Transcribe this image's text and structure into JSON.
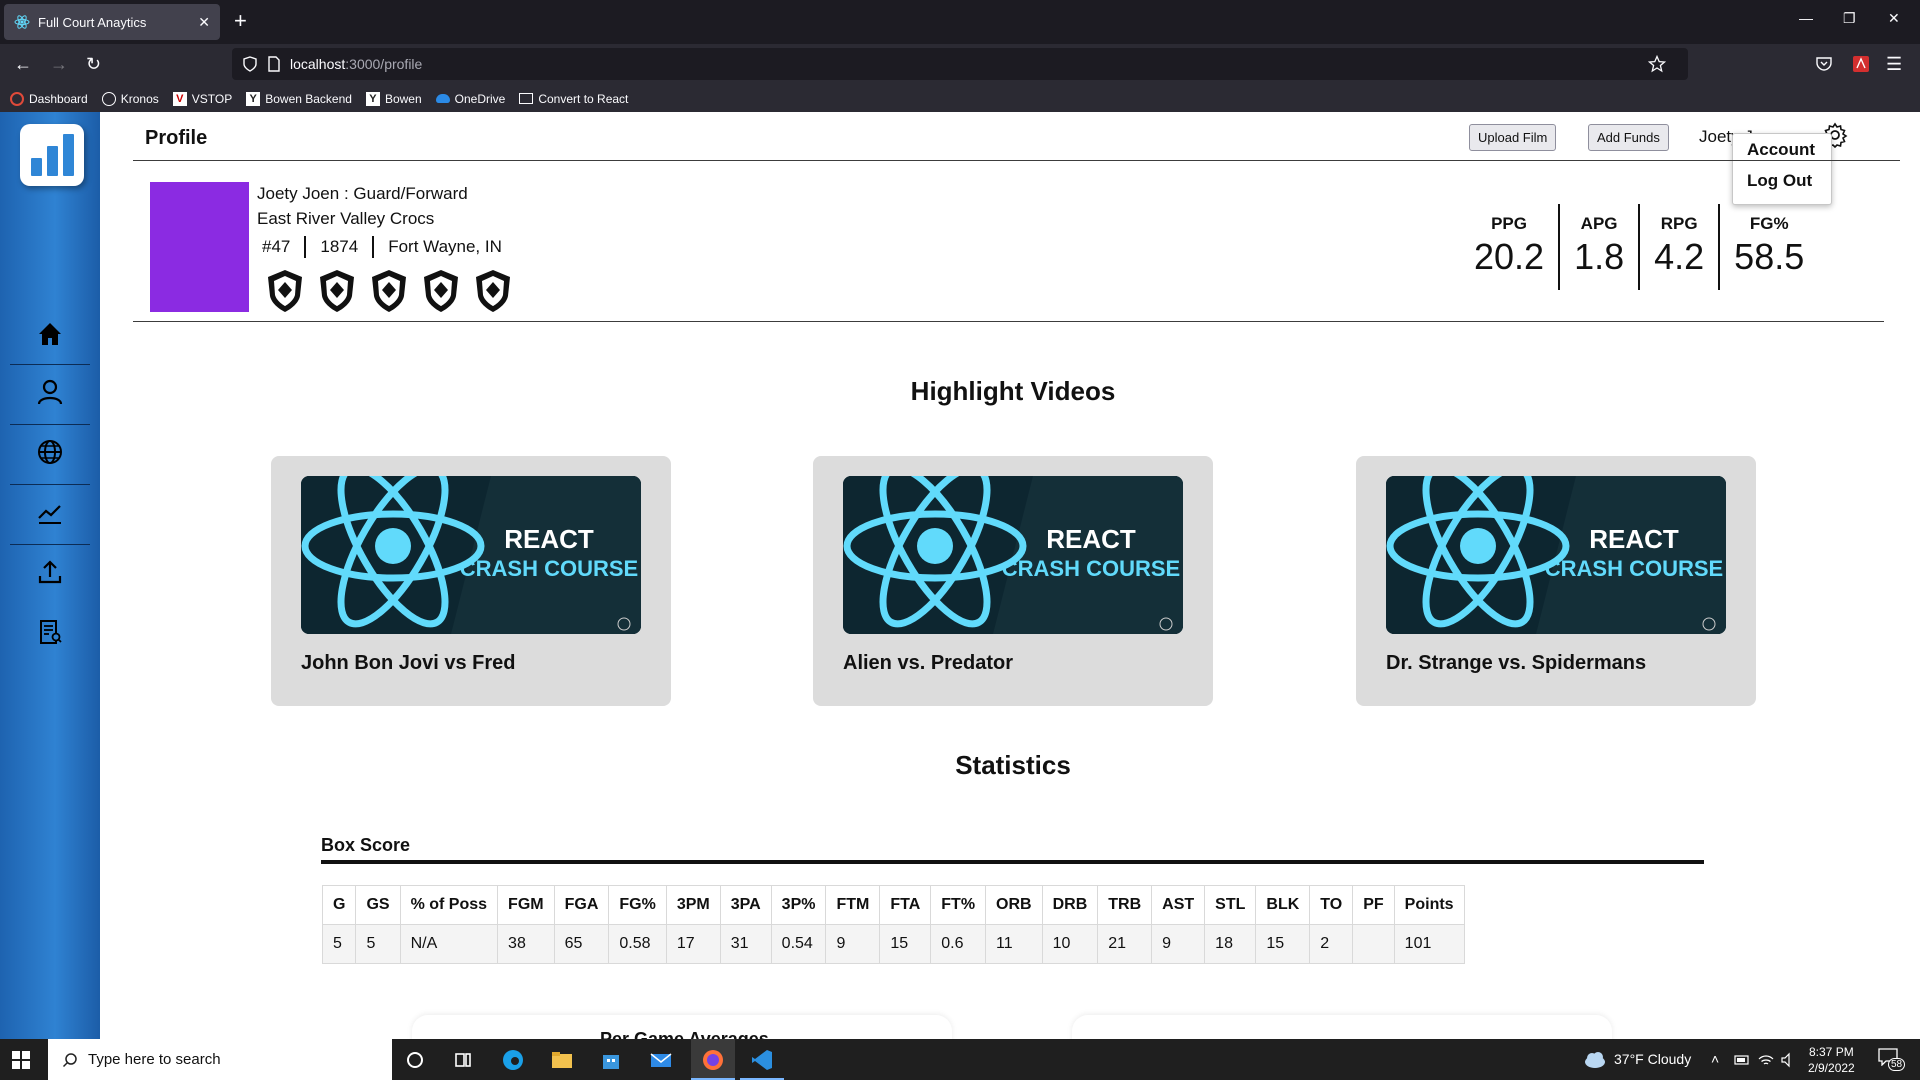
{
  "browser": {
    "tab_title": "Full Court Anaytics",
    "tab_close": "✕",
    "new_tab": "+",
    "url_host": "localhost",
    "url_path": ":3000/profile",
    "bookmarks": [
      "Dashboard",
      "Kronos",
      "VSTOP",
      "Bowen Backend",
      "Bowen",
      "OneDrive",
      "Convert to React"
    ]
  },
  "header": {
    "title": "Profile",
    "upload_label": "Upload Film",
    "funds_label": "Add Funds",
    "username": "Joety Joen",
    "menu": [
      "Account",
      "Log Out"
    ]
  },
  "profile": {
    "name_role": "Joety Joen : Guard/Forward",
    "team": "East River Valley Crocs",
    "number": "#47",
    "year": "1874",
    "location": "Fort Wayne, IN",
    "avatar_color": "#8b2be2",
    "badge_count": 5
  },
  "stats": [
    {
      "label": "PPG",
      "value": "20.2"
    },
    {
      "label": "APG",
      "value": "1.8"
    },
    {
      "label": "RPG",
      "value": "4.2"
    },
    {
      "label": "FG%",
      "value": "58.5"
    }
  ],
  "highlights": {
    "title": "Highlight Videos",
    "thumb_line1": "REACT",
    "thumb_line2": "CRASH COURSE",
    "videos": [
      {
        "title": "John Bon Jovi vs Fred"
      },
      {
        "title": "Alien vs. Predator"
      },
      {
        "title": "Dr. Strange vs. Spidermans"
      }
    ]
  },
  "statistics": {
    "title": "Statistics",
    "box_title": "Box Score",
    "columns": [
      "G",
      "GS",
      "% of Poss",
      "FGM",
      "FGA",
      "FG%",
      "3PM",
      "3PA",
      "3P%",
      "FTM",
      "FTA",
      "FT%",
      "ORB",
      "DRB",
      "TRB",
      "AST",
      "STL",
      "BLK",
      "TO",
      "PF",
      "Points"
    ],
    "row": [
      "5",
      "5",
      "N/A",
      "38",
      "65",
      "0.58",
      "17",
      "31",
      "0.54",
      "9",
      "15",
      "0.6",
      "11",
      "10",
      "21",
      "9",
      "18",
      "15",
      "2",
      "",
      "101"
    ],
    "per_game_title": "Per Game Averages"
  },
  "taskbar": {
    "search_placeholder": "Type here to search",
    "weather": "37°F  Cloudy",
    "time": "8:37 PM",
    "date": "2/9/2022",
    "notifications": "58"
  },
  "colors": {
    "sidebar": "#2f82d2",
    "react_blue": "#61dafb",
    "card_bg": "#dcdcdc"
  }
}
